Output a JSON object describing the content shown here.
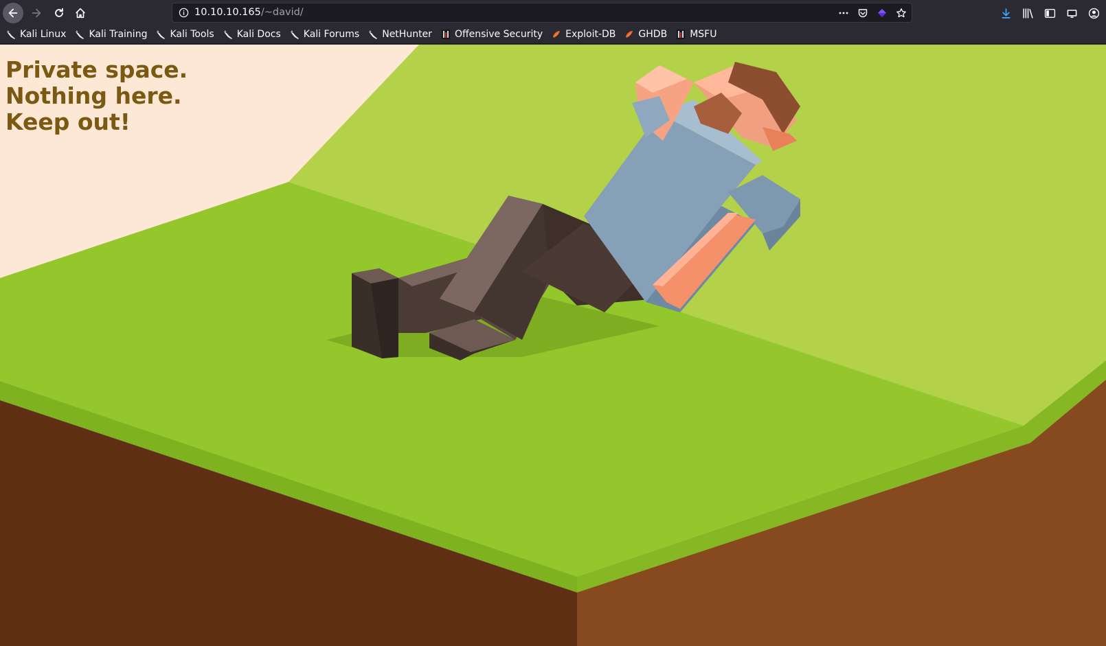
{
  "browser": {
    "url_host": "10.10.10.165",
    "url_path": "/~david/",
    "bookmarks": [
      {
        "label": "Kali Linux",
        "icon": "kali-dragon-icon"
      },
      {
        "label": "Kali Training",
        "icon": "kali-dragon-icon"
      },
      {
        "label": "Kali Tools",
        "icon": "kali-dragon-icon"
      },
      {
        "label": "Kali Docs",
        "icon": "kali-dragon-icon"
      },
      {
        "label": "Kali Forums",
        "icon": "kali-dragon-icon"
      },
      {
        "label": "NetHunter",
        "icon": "kali-dragon-icon"
      },
      {
        "label": "Offensive Security",
        "icon": "offsec-icon"
      },
      {
        "label": "Exploit-DB",
        "icon": "exploitdb-icon"
      },
      {
        "label": "GHDB",
        "icon": "exploitdb-icon"
      },
      {
        "label": "MSFU",
        "icon": "offsec-icon"
      }
    ]
  },
  "page": {
    "lines": [
      "Private space.",
      "Nothing here.",
      "Keep out!"
    ],
    "text_color": "#7a5a12"
  },
  "colors": {
    "grass_light": "#b3d24a",
    "grass_mid": "#93c72c",
    "dirt_dark": "#5e2f12",
    "dirt_light": "#874a1f",
    "sky": "#fde8d6"
  }
}
